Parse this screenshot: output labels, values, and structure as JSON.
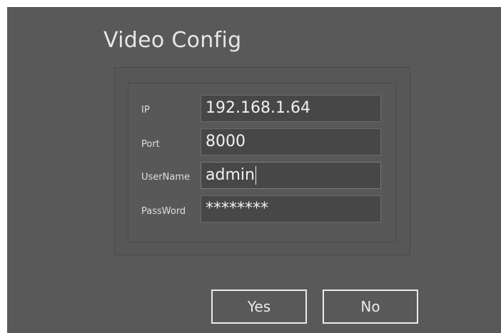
{
  "dialog": {
    "title": "Video Config"
  },
  "form": {
    "ip": {
      "label": "IP",
      "value": "192.168.1.64"
    },
    "port": {
      "label": "Port",
      "value": "8000"
    },
    "username": {
      "label": "UserName",
      "value": "admin"
    },
    "password": {
      "label": "PassWord",
      "value": "********"
    }
  },
  "buttons": {
    "yes_label": "Yes",
    "no_label": "No"
  },
  "colors": {
    "background": "#595959",
    "field_background": "#474747",
    "text": "#eaeaea"
  }
}
